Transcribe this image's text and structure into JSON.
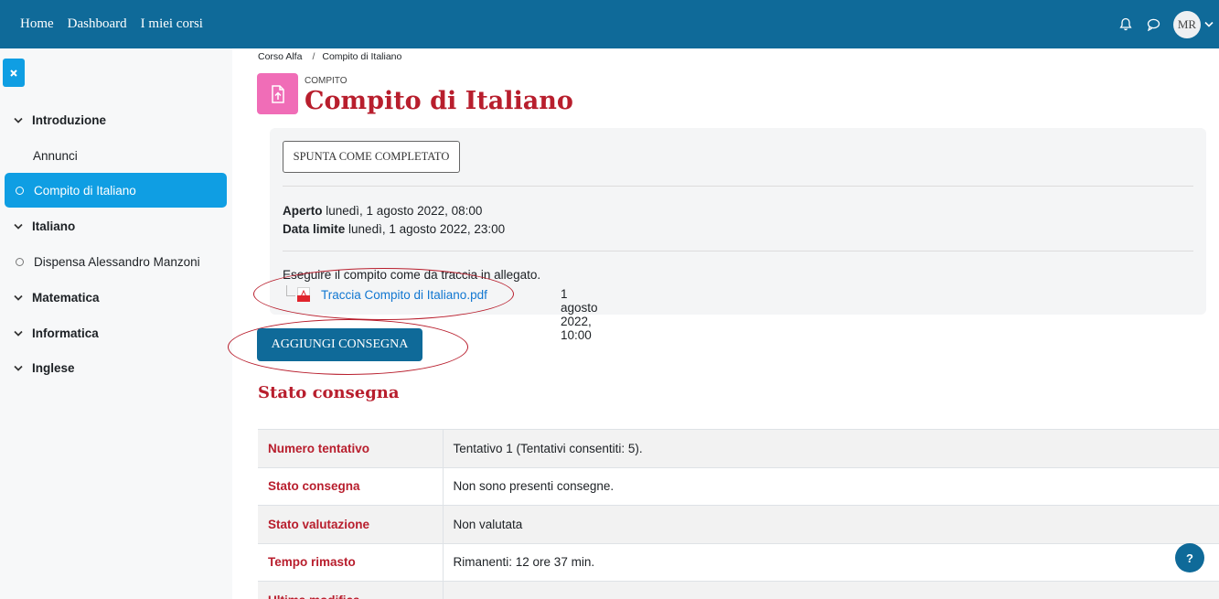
{
  "navbar": {
    "links": [
      "Home",
      "Dashboard",
      "I miei corsi"
    ],
    "avatar_initials": "MR",
    "icons": [
      "bell-icon",
      "chat-icon",
      "chevron-down-icon"
    ]
  },
  "sidebar": {
    "close_icon": "close-icon",
    "items": [
      {
        "type": "section",
        "label": "Introduzione"
      },
      {
        "type": "activity",
        "label": "Annunci"
      },
      {
        "type": "activity",
        "label": "Compito di Italiano",
        "active": true
      },
      {
        "type": "section",
        "label": "Italiano"
      },
      {
        "type": "activity",
        "label": "Dispensa Alessandro Manzoni"
      },
      {
        "type": "section",
        "label": "Matematica"
      },
      {
        "type": "section",
        "label": "Informatica"
      },
      {
        "type": "section",
        "label": "Inglese"
      }
    ]
  },
  "breadcrumb": {
    "course": "Corso Alfa",
    "separator": "/",
    "current": "Compito di Italiano"
  },
  "header": {
    "pre": "COMPITO",
    "title": "Compito di Italiano"
  },
  "activity_info": {
    "complete_button": "SPUNTA COME COMPLETATO",
    "opened_label": "Aperto",
    "opened_value": "lunedì, 1 agosto 2022, 08:00",
    "due_label": "Data limite",
    "due_value": "lunedì, 1 agosto 2022, 23:00",
    "description": "Eseguire il compito come da traccia in allegato.",
    "attachment_name": "Traccia Compito di Italiano.pdf",
    "attachment_date": "1 agosto 2022, 10:00"
  },
  "add_submission_button": "AGGIUNGI CONSEGNA",
  "status": {
    "title": "Stato consegna",
    "rows": [
      {
        "label": "Numero tentativo",
        "value": "Tentativo 1 (Tentativi consentiti: 5)."
      },
      {
        "label": "Stato consegna",
        "value": "Non sono presenti consegne."
      },
      {
        "label": "Stato valutazione",
        "value": "Non valutata"
      },
      {
        "label": "Tempo rimasto",
        "value": "Rimanenti: 12 ore 37 min."
      },
      {
        "label": "Ultima modifica",
        "value": ""
      }
    ]
  },
  "help_button": "?",
  "colors": {
    "navbar": "#0f6a99",
    "accent": "#0f9ee3",
    "title_red": "#b81e2d",
    "activity_icon": "#f06db7"
  }
}
